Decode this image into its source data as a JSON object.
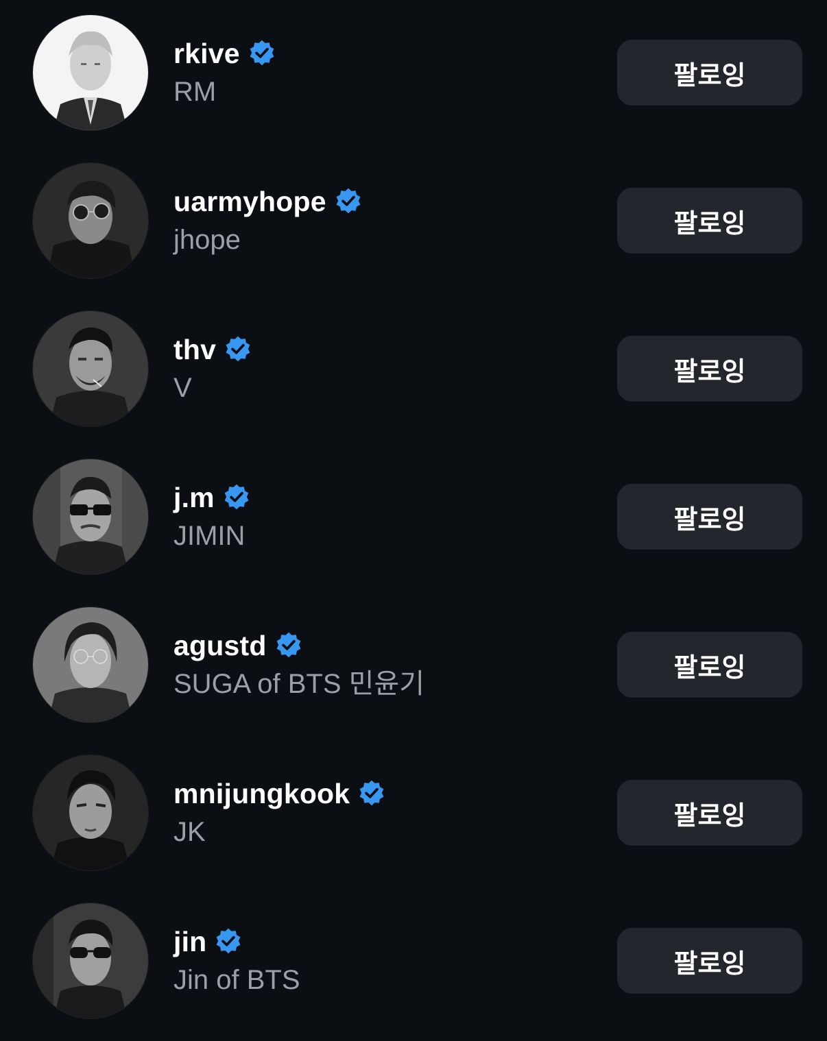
{
  "following": [
    {
      "username": "rkive",
      "display_name": "RM",
      "verified": true,
      "button_label": "팔로잉",
      "avatar": "avatar-rkive",
      "avatar_tone": "light"
    },
    {
      "username": "uarmyhope",
      "display_name": "jhope",
      "verified": true,
      "button_label": "팔로잉",
      "avatar": "avatar-uarmyhope",
      "avatar_tone": "dark"
    },
    {
      "username": "thv",
      "display_name": "V",
      "verified": true,
      "button_label": "팔로잉",
      "avatar": "avatar-thv",
      "avatar_tone": "dark"
    },
    {
      "username": "j.m",
      "display_name": "JIMIN",
      "verified": true,
      "button_label": "팔로잉",
      "avatar": "avatar-jm",
      "avatar_tone": "dark"
    },
    {
      "username": "agustd",
      "display_name": "SUGA of BTS 민윤기",
      "verified": true,
      "button_label": "팔로잉",
      "avatar": "avatar-agustd",
      "avatar_tone": "dark"
    },
    {
      "username": "mnijungkook",
      "display_name": "JK",
      "verified": true,
      "button_label": "팔로잉",
      "avatar": "avatar-mnijungkook",
      "avatar_tone": "dark"
    },
    {
      "username": "jin",
      "display_name": "Jin of BTS",
      "verified": true,
      "button_label": "팔로잉",
      "avatar": "avatar-jin",
      "avatar_tone": "dark"
    }
  ],
  "colors": {
    "background": "#0b0e13",
    "button_bg": "#23262d",
    "verified_blue": "#3897f0",
    "secondary_text": "#9aa0a8"
  },
  "icons": {
    "verified": "verified-badge-icon"
  }
}
